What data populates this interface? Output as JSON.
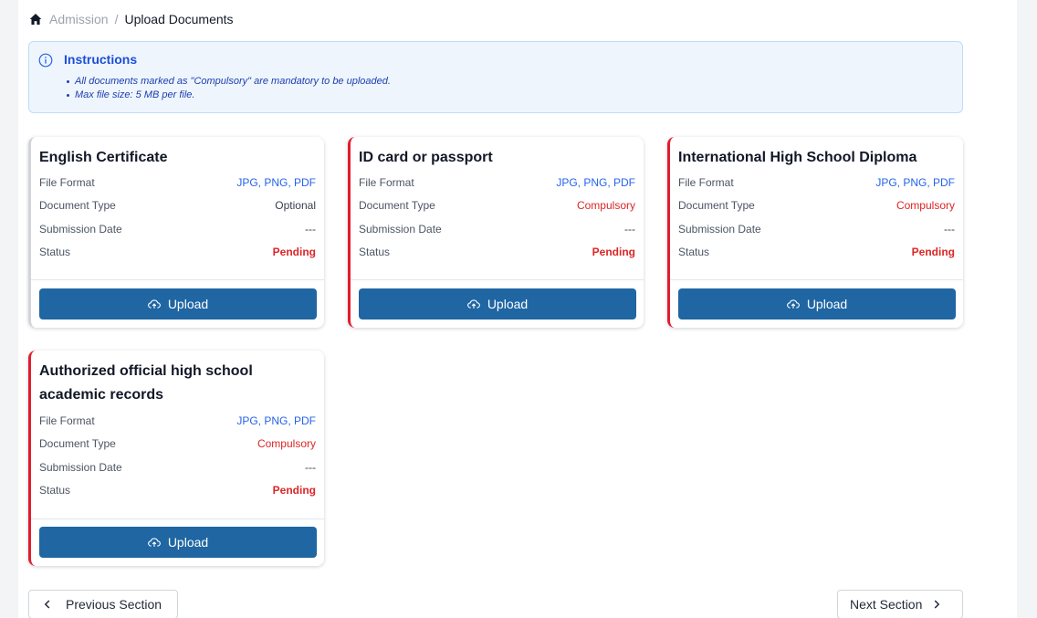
{
  "breadcrumb": {
    "home_icon": "home-icon",
    "parent": "Admission",
    "separator": "/",
    "current": "Upload Documents"
  },
  "instructions": {
    "icon": "info-icon",
    "title": "Instructions",
    "items": [
      "All documents marked as \"Compulsory\" are mandatory to be uploaded.",
      "Max file size: 5 MB per file."
    ]
  },
  "labels": {
    "file_format": "File Format",
    "document_type": "Document Type",
    "submission_date": "Submission Date",
    "status": "Status",
    "upload": "Upload"
  },
  "documents": [
    {
      "title": "English Certificate",
      "file_format": "JPG, PNG, PDF",
      "document_type": "Optional",
      "submission_date": "---",
      "status": "Pending"
    },
    {
      "title": "ID card or passport",
      "file_format": "JPG, PNG, PDF",
      "document_type": "Compulsory",
      "submission_date": "---",
      "status": "Pending"
    },
    {
      "title": "International High School Diploma",
      "file_format": "JPG, PNG, PDF",
      "document_type": "Compulsory",
      "submission_date": "---",
      "status": "Pending"
    },
    {
      "title": "Authorized official high school academic records",
      "file_format": "JPG, PNG, PDF",
      "document_type": "Compulsory",
      "submission_date": "---",
      "status": "Pending"
    }
  ],
  "navigation": {
    "previous": "Previous Section",
    "next": "Next Section"
  },
  "colors": {
    "primary_button": "#1f66a3",
    "compulsory_accent": "#e11d2e",
    "link_blue": "#2563eb",
    "pending_red": "#dc2626"
  }
}
